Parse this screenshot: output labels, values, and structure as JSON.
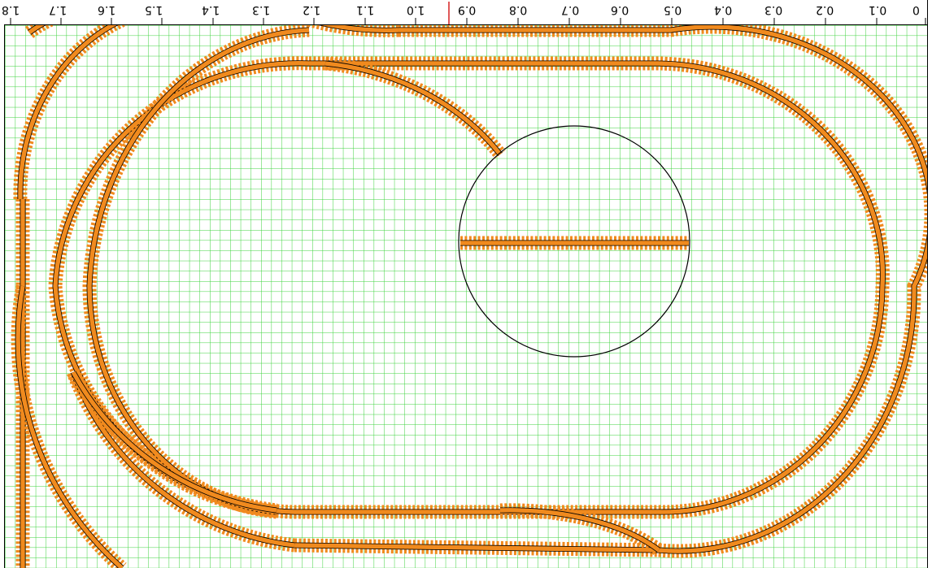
{
  "ruler": {
    "labels": [
      "1.8",
      "1.7",
      "1.6",
      "1.5",
      "1.4",
      "1.3",
      "1.2",
      "1.1",
      "1.0",
      "0.9",
      "0.8",
      "0.7",
      "0.6",
      "0.5",
      "0.4",
      "0.3",
      "0.2",
      "0.1",
      "0"
    ]
  },
  "colors": {
    "grid": "#3bd23b",
    "background": "#ffffff",
    "sleeper": "#f08a1e",
    "rail": "#000000",
    "turntable_outline": "#000000",
    "marker": "#d62020"
  },
  "tools": {
    "turntable_icon": "turntable-icon"
  }
}
